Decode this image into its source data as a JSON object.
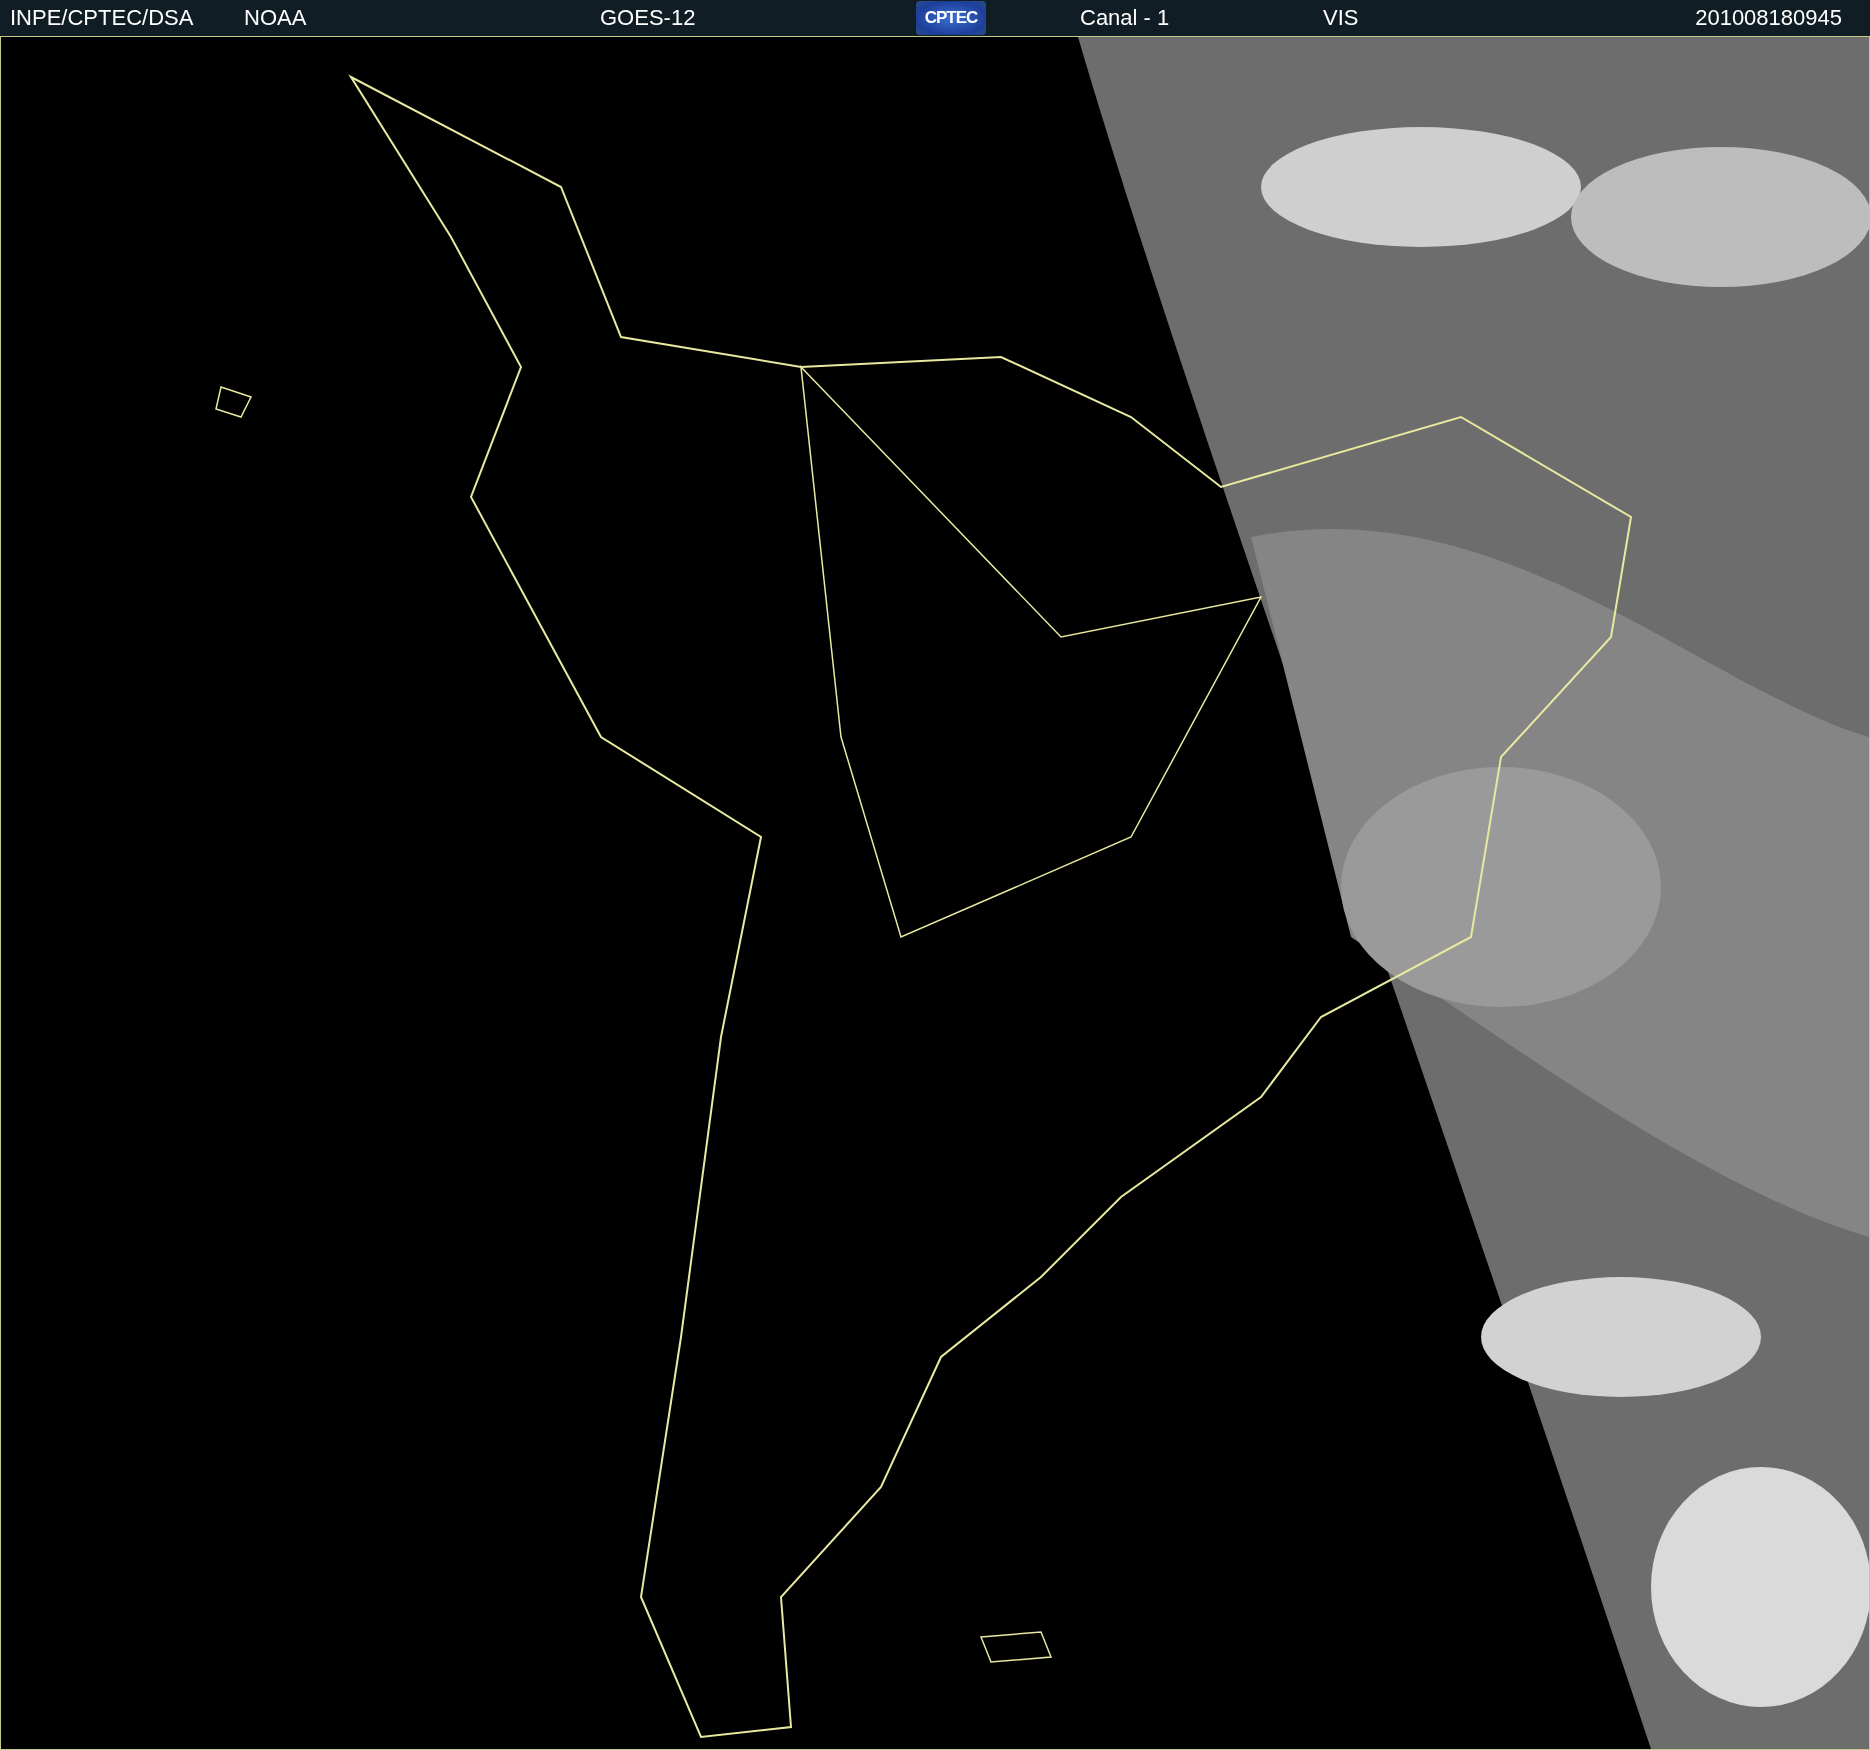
{
  "header": {
    "items": [
      {
        "kind": "text",
        "text": "INPE/CPTEC/DSA"
      },
      {
        "kind": "text",
        "text": "NOAA"
      },
      {
        "kind": "text",
        "text": "GOES-12"
      },
      {
        "kind": "logo",
        "text": "CPTEC"
      },
      {
        "kind": "text",
        "text": "Canal - 1"
      },
      {
        "kind": "text",
        "text": "VIS"
      },
      {
        "kind": "text",
        "text": "201008180945"
      }
    ]
  }
}
